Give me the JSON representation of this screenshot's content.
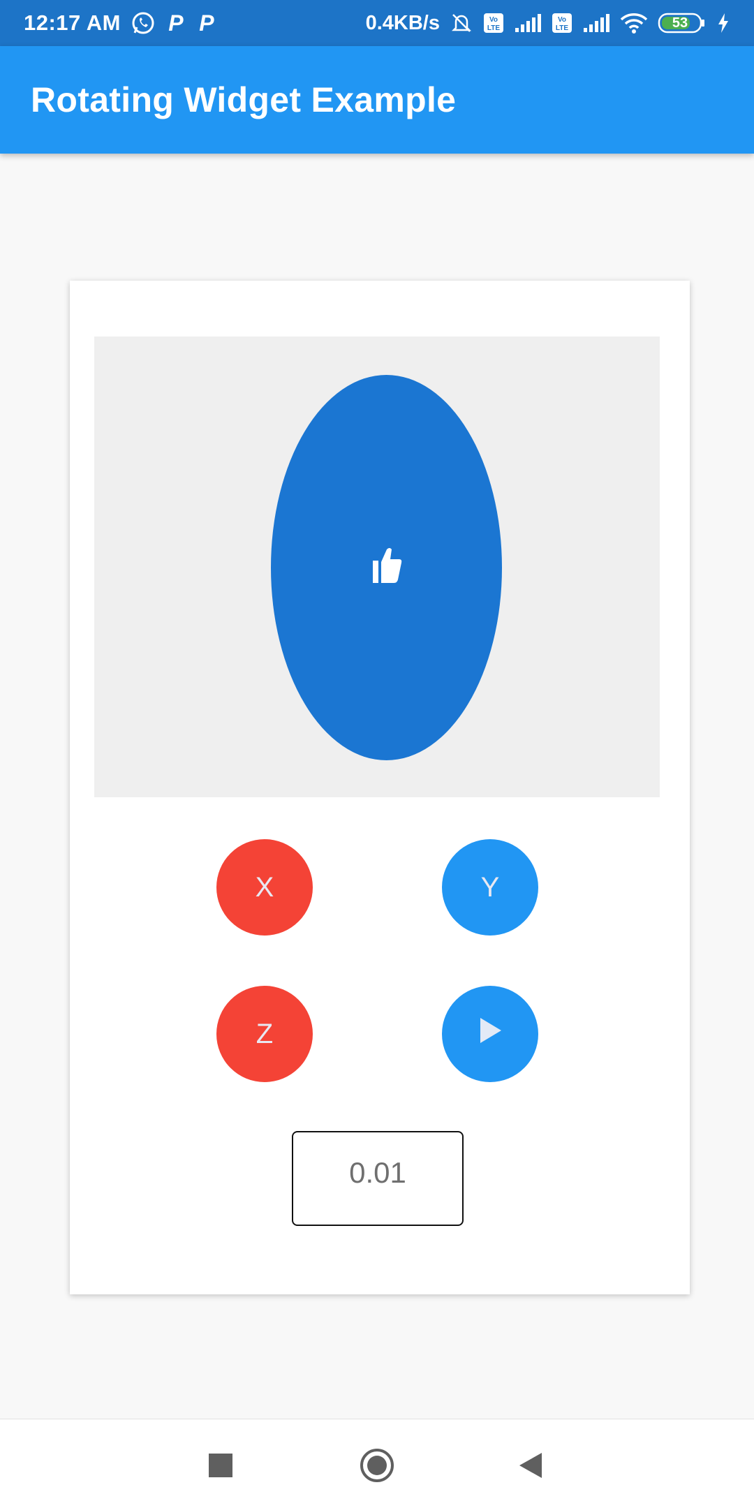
{
  "status_bar": {
    "time": "12:17 AM",
    "net_speed": "0.4KB/s",
    "battery": "53",
    "icons": [
      "whatsapp-icon",
      "p-app-icon",
      "p-app-icon",
      "bell-off-icon",
      "volte-icon",
      "signal-icon",
      "volte-icon",
      "signal-icon",
      "wifi-icon",
      "battery-icon",
      "charging-icon"
    ],
    "p_glyph": "P"
  },
  "app_bar": {
    "title": "Rotating Widget Example"
  },
  "rotating_widget": {
    "shape_color": "#1b76d2",
    "icon": "thumb-up-icon"
  },
  "controls": {
    "x_label": "X",
    "y_label": "Y",
    "z_label": "Z",
    "play_icon": "play-icon"
  },
  "step_input": {
    "value": "0.01"
  },
  "nav_bar": {
    "icons": [
      "recents-square-icon",
      "home-circle-icon",
      "back-triangle-icon"
    ]
  },
  "colors": {
    "primary": "#2196f3",
    "primary_dark": "#1d74c7",
    "accent_red": "#f44336"
  }
}
